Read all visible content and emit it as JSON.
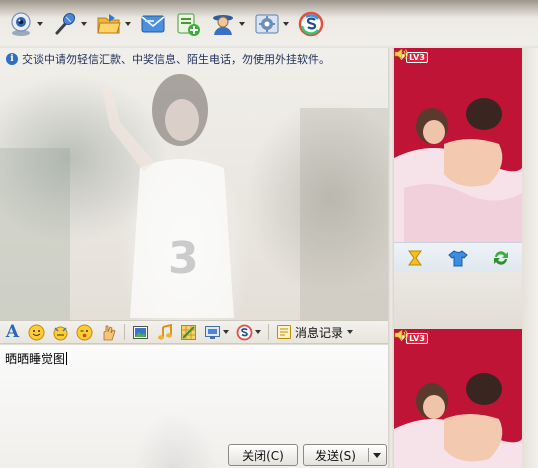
{
  "toolbar": {
    "items": [
      {
        "icon": "webcam-icon",
        "has_menu": true
      },
      {
        "icon": "microphone-icon",
        "has_menu": true
      },
      {
        "icon": "folder-open-icon",
        "has_menu": true
      },
      {
        "icon": "email-icon",
        "has_menu": false
      },
      {
        "icon": "add-note-icon",
        "has_menu": false
      },
      {
        "icon": "user-card-icon",
        "has_menu": true
      },
      {
        "icon": "settings-panel-icon",
        "has_menu": true
      },
      {
        "icon": "s-logo-icon",
        "has_menu": false
      }
    ]
  },
  "chat": {
    "notice": "交谈中请勿轻信汇款、中奖信息、陌生电话，勿使用外挂软件。"
  },
  "input_toolbar": {
    "font_icon_label": "A",
    "history_label": "消息记录"
  },
  "input": {
    "text": "晒晒睡觉图"
  },
  "buttons": {
    "close_label": "关闭(C)",
    "send_label": "发送(S)"
  },
  "video": {
    "level_badge": "LV3"
  },
  "colors": {
    "video_bg": "#c01437",
    "accent_blue": "#2a67b8"
  }
}
